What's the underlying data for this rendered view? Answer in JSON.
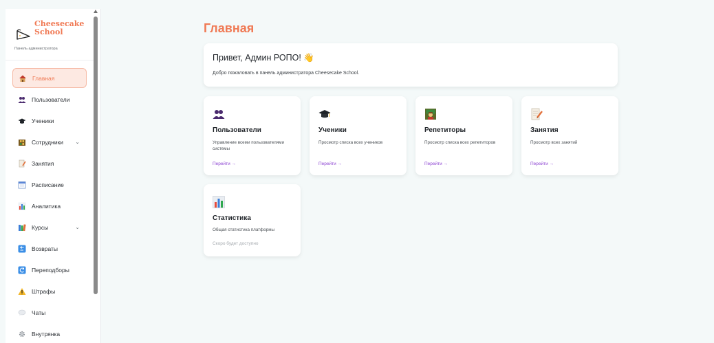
{
  "sidebar": {
    "brand_name_line1": "Cheesecake",
    "brand_name_line2": "School",
    "brand_subtitle": "Панель администратора",
    "items": [
      {
        "label": "Главная",
        "icon": "house-icon",
        "active": true
      },
      {
        "label": "Пользователи",
        "icon": "users-icon"
      },
      {
        "label": "Ученики",
        "icon": "graduation-cap-icon"
      },
      {
        "label": "Сотрудники",
        "icon": "staff-icon",
        "has_submenu": true
      },
      {
        "label": "Занятия",
        "icon": "memo-icon"
      },
      {
        "label": "Расписание",
        "icon": "calendar-icon"
      },
      {
        "label": "Аналитика",
        "icon": "bar-chart-icon"
      },
      {
        "label": "Курсы",
        "icon": "books-icon",
        "has_submenu": true
      },
      {
        "label": "Возвраты",
        "icon": "return-icon"
      },
      {
        "label": "Переподборы",
        "icon": "reassign-icon"
      },
      {
        "label": "Штрафы",
        "icon": "warning-icon"
      },
      {
        "label": "Чаты",
        "icon": "chat-icon"
      },
      {
        "label": "Внутрянка",
        "icon": "gear-icon"
      }
    ]
  },
  "main": {
    "title": "Главная",
    "welcome_title": "Привет, Админ РОПО! 👋",
    "welcome_text": "Добро пожаловать в панель администратора Cheesecake School.",
    "cards": [
      {
        "title": "Пользователи",
        "description": "Управление всеми пользователями системы",
        "action": "Перейти →",
        "icon": "users-icon"
      },
      {
        "title": "Ученики",
        "description": "Просмотр списка всех учеников",
        "action": "Перейти →",
        "icon": "graduation-cap-icon"
      },
      {
        "title": "Репетиторы",
        "description": "Просмотр списка всех репетиторов",
        "action": "Перейти →",
        "icon": "tutor-icon"
      },
      {
        "title": "Занятия",
        "description": "Просмотр всех занятий",
        "action": "Перейти →",
        "icon": "memo-icon"
      },
      {
        "title": "Статистика",
        "description": "Общая статистика платформы",
        "action": "Скоро будет доступно",
        "icon": "bar-chart-icon",
        "disabled": true
      }
    ]
  },
  "colors": {
    "accent": "#f07a55",
    "link": "#8a3fd1",
    "background": "#f4f9f9"
  }
}
